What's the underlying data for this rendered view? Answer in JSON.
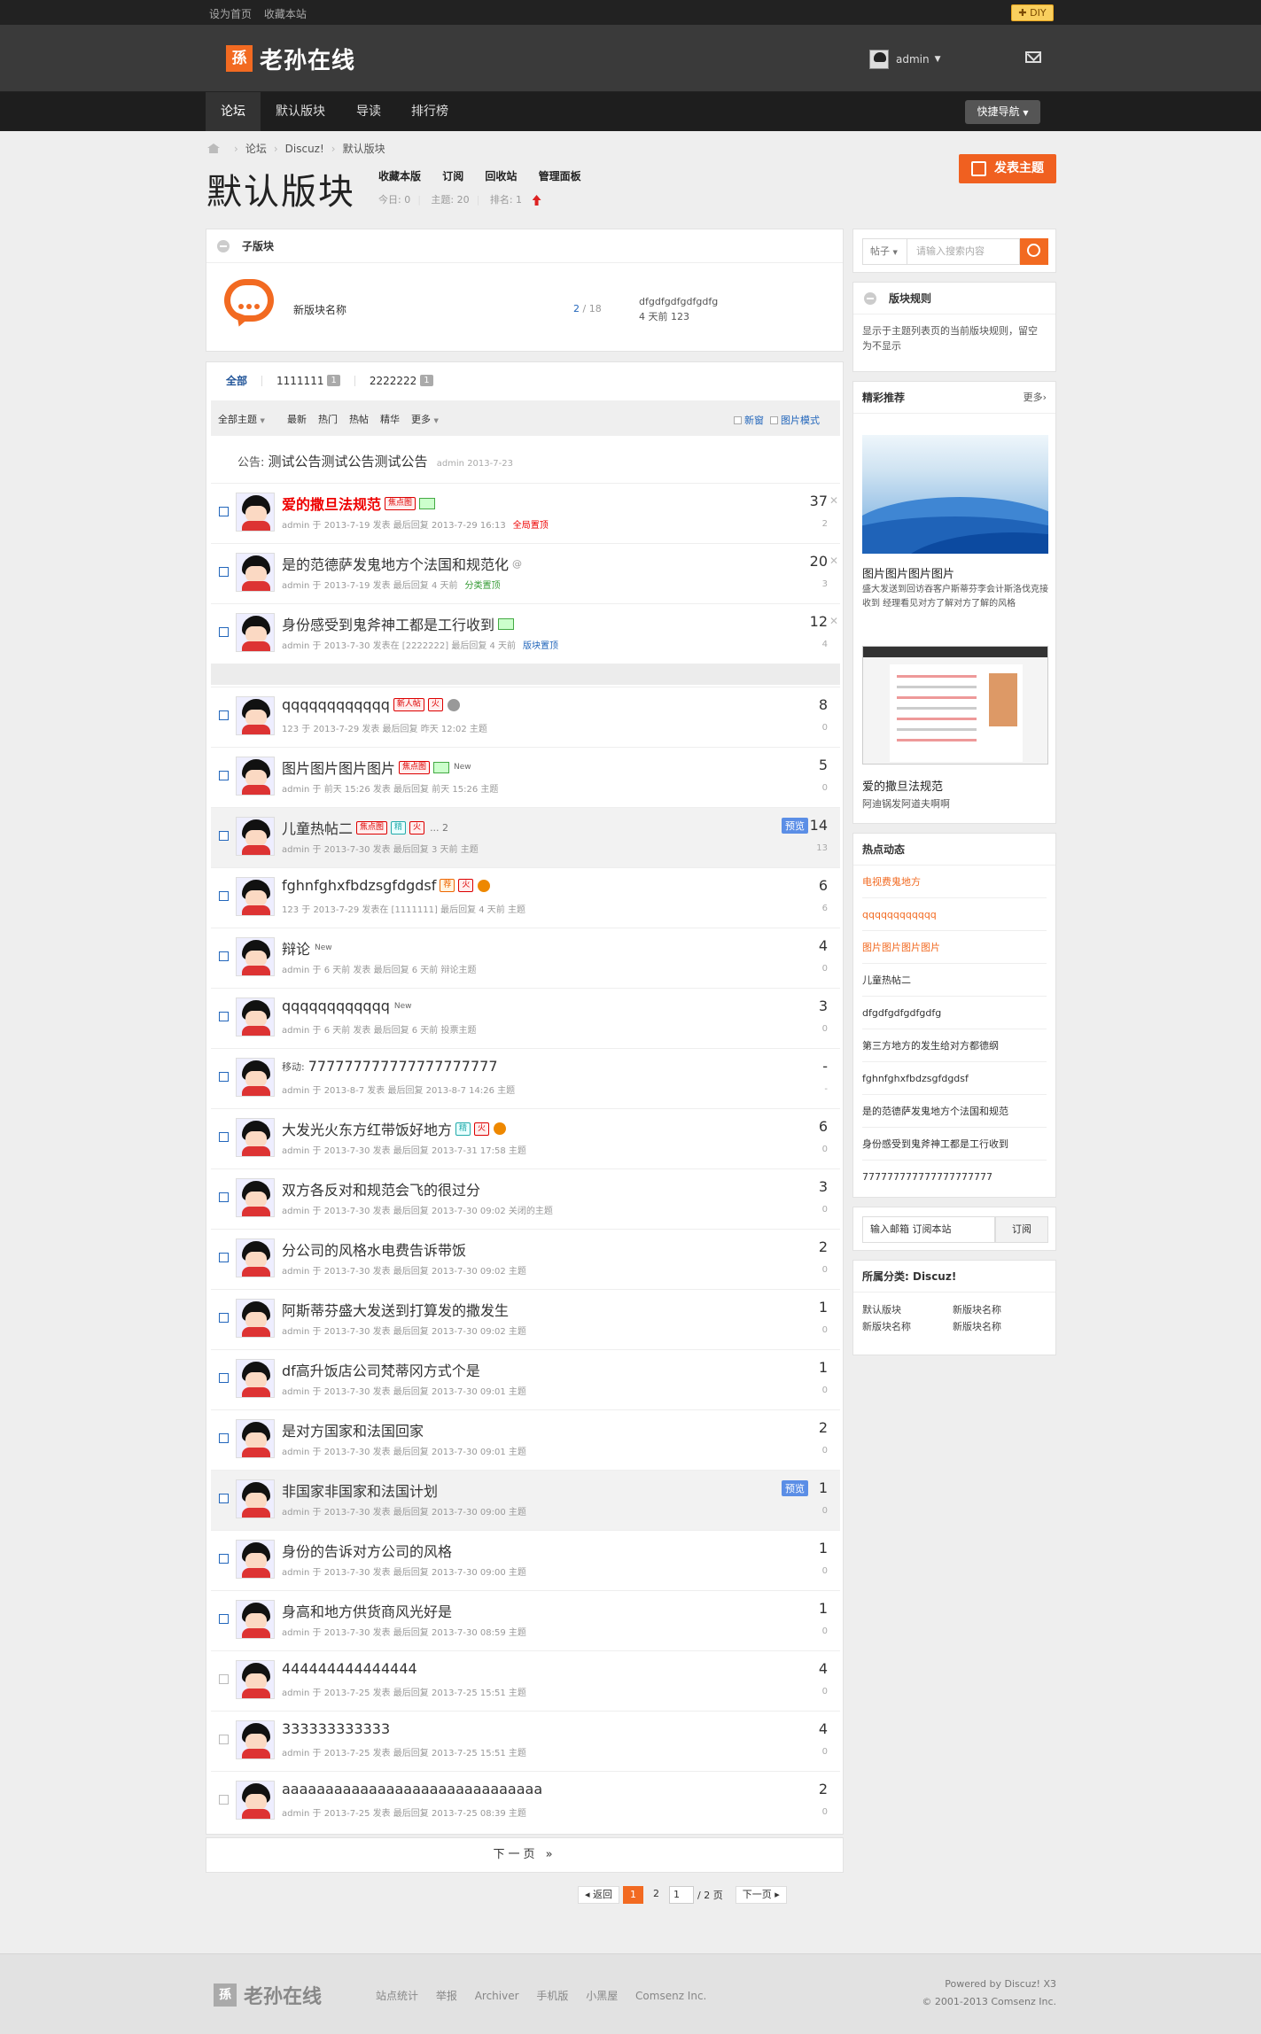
{
  "topbar": {
    "links": [
      "设为首页",
      "收藏本站"
    ],
    "diy_label": "DIY"
  },
  "header": {
    "logo_mark": "孫",
    "logo_text": "老孙在线",
    "username": "admin"
  },
  "nav": {
    "items": [
      "论坛",
      "默认版块",
      "导读",
      "排行榜"
    ],
    "quick_nav": "快捷导航"
  },
  "breadcrumb": [
    "论坛",
    "Discuz!",
    "默认版块"
  ],
  "forum": {
    "title": "默认版块",
    "actions": [
      "收藏本版",
      "订阅",
      "回收站",
      "管理面板"
    ],
    "today": "今日: 0",
    "topics": "主题: 20",
    "rank": "排名: 1",
    "post_button": "发表主题"
  },
  "subforum": {
    "header": "子版块",
    "name": "新版块名称",
    "count_a": "2",
    "count_b": "/ 18",
    "last_title": "dfgdfgdfgdfgdfg",
    "last_time": "4 天前 123"
  },
  "tabs": [
    {
      "label": "全部",
      "badge": ""
    },
    {
      "label": "1111111",
      "badge": "1"
    },
    {
      "label": "2222222",
      "badge": "1"
    }
  ],
  "filters": [
    "全部主题",
    "最新",
    "热门",
    "热帖",
    "精华",
    "更多"
  ],
  "filter_checks": [
    "新窗",
    "图片模式"
  ],
  "announcement": {
    "prefix": "公告:",
    "title": "测试公告测试公告测试公告",
    "meta": "admin 2013-7-23"
  },
  "threads": [
    {
      "title": "爱的撒旦法规范",
      "meta": "admin 于 2013-7-19 发表 最后回复 2013-7-29 16:13",
      "flag": "全局置顶",
      "flag_color": "r",
      "replies": "37",
      "views": "2"
    },
    {
      "title": "是的范德萨发鬼地方个法国和规范化",
      "meta": "admin 于 2013-7-19 发表 最后回复 4 天前",
      "flag": "分类置顶",
      "flag_color": "g",
      "replies": "20",
      "views": "3"
    },
    {
      "title": "身份感受到鬼斧神工都是工行收到",
      "meta": "admin 于 2013-7-30 发表在 [2222222] 最后回复 4 天前",
      "flag": "版块置顶",
      "flag_color": "b",
      "replies": "12",
      "views": "4"
    },
    {
      "title": "qqqqqqqqqqqq",
      "meta": "123 于 2013-7-29 发表 最后回复 昨天 12:02 主题",
      "flag": "",
      "flag_color": "",
      "replies": "8",
      "views": "0"
    },
    {
      "title": "图片图片图片图片",
      "meta": "admin 于 前天 15:26 发表 最后回复 前天 15:26 主题",
      "flag": "",
      "flag_color": "",
      "replies": "5",
      "views": "0"
    },
    {
      "title": "儿童热帖二",
      "meta": "admin 于 2013-7-30 发表 最后回复 3 天前 主题",
      "flag": "",
      "flag_color": "",
      "replies": "14",
      "views": "13"
    },
    {
      "title": "fghnfghxfbdzsgfdgdsf",
      "meta": "123 于 2013-7-29 发表在 [1111111] 最后回复 4 天前 主题",
      "flag": "",
      "flag_color": "",
      "replies": "6",
      "views": "6"
    },
    {
      "title": "辩论",
      "meta": "admin 于 6 天前 发表 最后回复 6 天前 辩论主题",
      "flag": "",
      "flag_color": "",
      "replies": "4",
      "views": "0"
    },
    {
      "title": "qqqqqqqqqqqq",
      "meta": "admin 于 6 天前 发表 最后回复 6 天前 投票主题",
      "flag": "",
      "flag_color": "",
      "replies": "3",
      "views": "0"
    },
    {
      "title": "777777777777777777777",
      "prefix": "移动:",
      "meta": "admin 于 2013-8-7 发表 最后回复 2013-8-7 14:26 主题",
      "flag": "",
      "flag_color": "",
      "replies": "-",
      "views": "-"
    },
    {
      "title": "大发光火东方红带饭好地方",
      "meta": "admin 于 2013-7-30 发表 最后回复 2013-7-31 17:58 主题",
      "flag": "",
      "flag_color": "",
      "replies": "6",
      "views": "0"
    },
    {
      "title": "双方各反对和规范会飞的很过分",
      "meta": "admin 于 2013-7-30 发表 最后回复 2013-7-30 09:02 关闭的主题",
      "flag": "",
      "flag_color": "",
      "replies": "3",
      "views": "0"
    },
    {
      "title": "分公司的风格水电费告诉带饭",
      "meta": "admin 于 2013-7-30 发表 最后回复 2013-7-30 09:02 主题",
      "flag": "",
      "flag_color": "",
      "replies": "2",
      "views": "0"
    },
    {
      "title": "阿斯蒂芬盛大发送到打算发的撒发生",
      "meta": "admin 于 2013-7-30 发表 最后回复 2013-7-30 09:02 主题",
      "flag": "",
      "flag_color": "",
      "replies": "1",
      "views": "0"
    },
    {
      "title": "df高升饭店公司梵蒂冈方式个是",
      "meta": "admin 于 2013-7-30 发表 最后回复 2013-7-30 09:01 主题",
      "flag": "",
      "flag_color": "",
      "replies": "1",
      "views": "0"
    },
    {
      "title": "是对方国家和法国回家",
      "meta": "admin 于 2013-7-30 发表 最后回复 2013-7-30 09:01 主题",
      "flag": "",
      "flag_color": "",
      "replies": "2",
      "views": "0"
    },
    {
      "title": "非国家非国家和法国计划",
      "meta": "admin 于 2013-7-30 发表 最后回复 2013-7-30 09:00 主题",
      "flag": "",
      "flag_color": "",
      "replies": "1",
      "views": "0"
    },
    {
      "title": "身份的告诉对方公司的风格",
      "meta": "admin 于 2013-7-30 发表 最后回复 2013-7-30 09:00 主题",
      "flag": "",
      "flag_color": "",
      "replies": "1",
      "views": "0"
    },
    {
      "title": "身高和地方供货商风光好是",
      "meta": "admin 于 2013-7-30 发表 最后回复 2013-7-30 08:59 主题",
      "flag": "",
      "flag_color": "",
      "replies": "1",
      "views": "0"
    },
    {
      "title": "444444444444444",
      "meta": "admin 于 2013-7-25 发表 最后回复 2013-7-25 15:51 主题",
      "flag": "",
      "flag_color": "",
      "replies": "4",
      "views": "0"
    },
    {
      "title": "333333333333",
      "meta": "admin 于 2013-7-25 发表 最后回复 2013-7-25 15:51 主题",
      "flag": "",
      "flag_color": "",
      "replies": "4",
      "views": "0"
    },
    {
      "title": "aaaaaaaaaaaaaaaaaaaaaaaaaaaaaa",
      "meta": "admin 于 2013-7-25 发表 最后回复 2013-7-25 08:39 主题",
      "flag": "",
      "flag_color": "",
      "replies": "2",
      "views": "0"
    }
  ],
  "badges": {
    "focus": "焦点图",
    "new_person": "新人帖",
    "fire": "火",
    "elite": "精",
    "recommend": "荐",
    "new": "New",
    "preview": "预览",
    "ellipsis": "... 2"
  },
  "pagination": {
    "next_page": "下一页 »",
    "back": "返回",
    "pages": [
      "1",
      "2"
    ],
    "current": "1",
    "total": "/ 2 页",
    "next": "下一页"
  },
  "sidebar": {
    "search_type": "帖子",
    "search_placeholder": "请输入搜索内容",
    "rules_header": "版块规则",
    "rules_text": "显示于主题列表页的当前版块规则，留空为不显示",
    "recommend_header": "精彩推荐",
    "recommend_more": "更多",
    "rec_title1": "图片图片图片图片",
    "rec_desc1": "盛大发送到回访吞客户斯蒂芬李会计斯洛伐克接收到 经理看见对方了解对方了解的风格",
    "rec_title2": "爱的撒旦法规范",
    "rec_desc2": "阿迪锅发阿道夫啊啊",
    "hot_header": "热点动态",
    "hot_items": [
      "电视费鬼地方",
      "qqqqqqqqqqqq",
      "图片图片图片图片",
      "儿童热帖二",
      "dfgdfgdfgdfgdfg",
      "第三方地方的发生给对方都德纲",
      "fghnfghxfbdzsgfdgdsf",
      "是的范德萨发鬼地方个法国和规范",
      "身份感受到鬼斧神工都是工行收到",
      "777777777777777777777"
    ],
    "subscribe_placeholder": "输入邮箱 订阅本站",
    "subscribe_button": "订阅",
    "category_header": "所属分类: Discuz!",
    "category_items": [
      "默认版块",
      "新版块名称",
      "新版块名称",
      "新版块名称"
    ]
  },
  "footer": {
    "logo_mark": "孫",
    "logo_text": "老孙在线",
    "links": [
      "站点统计",
      "举报",
      "Archiver",
      "手机版",
      "小黑屋",
      "Comsenz Inc."
    ],
    "powered": "Powered by Discuz! X3",
    "copyright": "© 2001-2013 Comsenz Inc."
  },
  "colors": {
    "accent": "#f26a21",
    "link": "#2266bb",
    "top_red": "#e00000"
  }
}
